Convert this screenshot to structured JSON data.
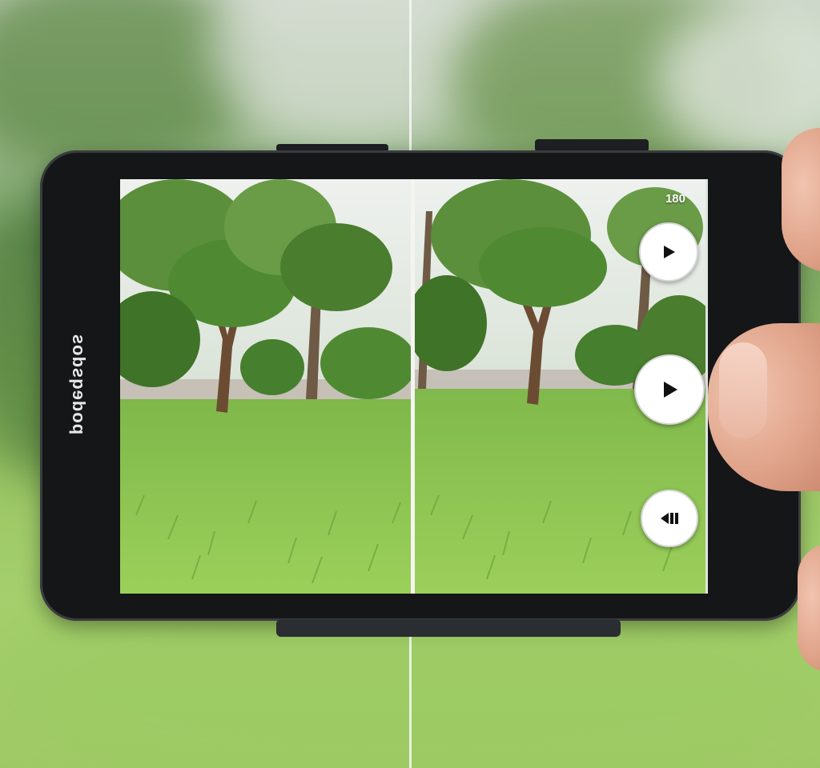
{
  "scene": "phone-camera-park-view",
  "phone": {
    "brand_text": "podeqsdos",
    "screen": {
      "timer_text": "180",
      "controls": [
        {
          "name": "play",
          "icon": "play-icon"
        },
        {
          "name": "play-large",
          "icon": "play-icon"
        },
        {
          "name": "rewind",
          "icon": "rewind-icon"
        }
      ]
    }
  },
  "colors": {
    "phone_body": "#151618",
    "grass": "#8cc34f",
    "tree_canopy": "#4e7f33",
    "sky": "#e3e8e3",
    "control_fill": "#ffffff",
    "icon": "#111111"
  }
}
